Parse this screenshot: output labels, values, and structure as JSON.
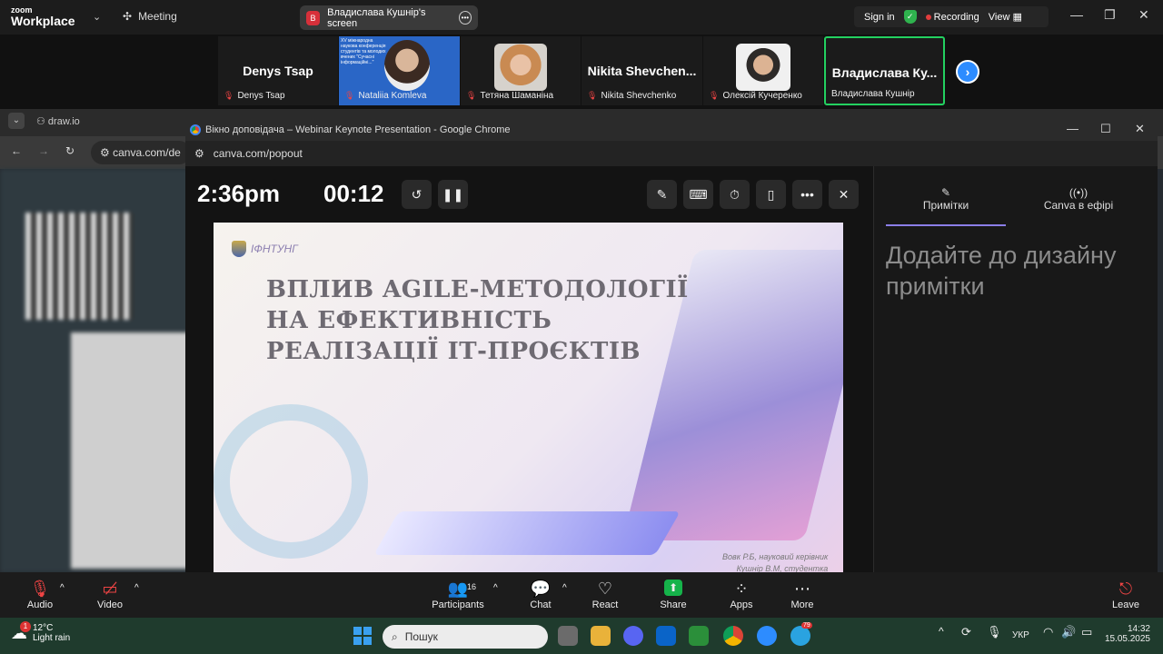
{
  "zoom": {
    "brand_small": "zoom",
    "brand": "Workplace",
    "meeting_label": "Meeting",
    "share_avatar": "B",
    "share_label": "Владислава Кушнір's screen",
    "signin": "Sign in",
    "recording": "Recording",
    "view": "View"
  },
  "participants": [
    {
      "name_big": "Denys Tsap",
      "label": "Denys Tsap"
    },
    {
      "label": "Nataliia Komleva",
      "slide_text": "XV міжнародна наукова конференція студентів та молодих вчених \"Сучасні інформаційні...\""
    },
    {
      "label": "Тетяна Шаманіна"
    },
    {
      "name_big": "Nikita  Shevchen...",
      "label": "Nikita Shevchenko"
    },
    {
      "label": "Олексій Кучеренко"
    },
    {
      "name_big": "Владислава  Ку...",
      "label": "Владислава Кушнір"
    }
  ],
  "bg_browser": {
    "tab": "draw.io",
    "address": "canva.com/de"
  },
  "popup": {
    "title": "Вікно доповідача – Webinar Keynote Presentation - Google Chrome",
    "address": "canva.com/popout",
    "clock": "2:36pm",
    "timer": "00:12",
    "slide": {
      "logo": "ІФНТУНГ",
      "title": "ВПЛИВ AGILE-МЕТОДОЛОГІЇ НА ЕФЕКТИВНІСТЬ РЕАЛІЗАЦІЇ ІТ-ПРОЄКТІВ",
      "caption1": "Вовк Р.Б, науковий керівник",
      "caption2": "Кушнір В.М, студентка"
    },
    "sidebar": {
      "tab_notes": "Примітки",
      "tab_live": "Canva в ефірі",
      "empty_msg": "Додайте до дизайну примітки"
    }
  },
  "controls": {
    "audio": "Audio",
    "video": "Video",
    "participants": "Participants",
    "participant_count": "16",
    "chat": "Chat",
    "react": "React",
    "share": "Share",
    "apps": "Apps",
    "more": "More",
    "leave": "Leave"
  },
  "taskbar": {
    "temp": "12°C",
    "weather": "Light rain",
    "weather_badge": "1",
    "search": "Пошук",
    "lang": "УКР",
    "time": "14:32",
    "date": "15.05.2025",
    "telegram_badge": "79"
  }
}
